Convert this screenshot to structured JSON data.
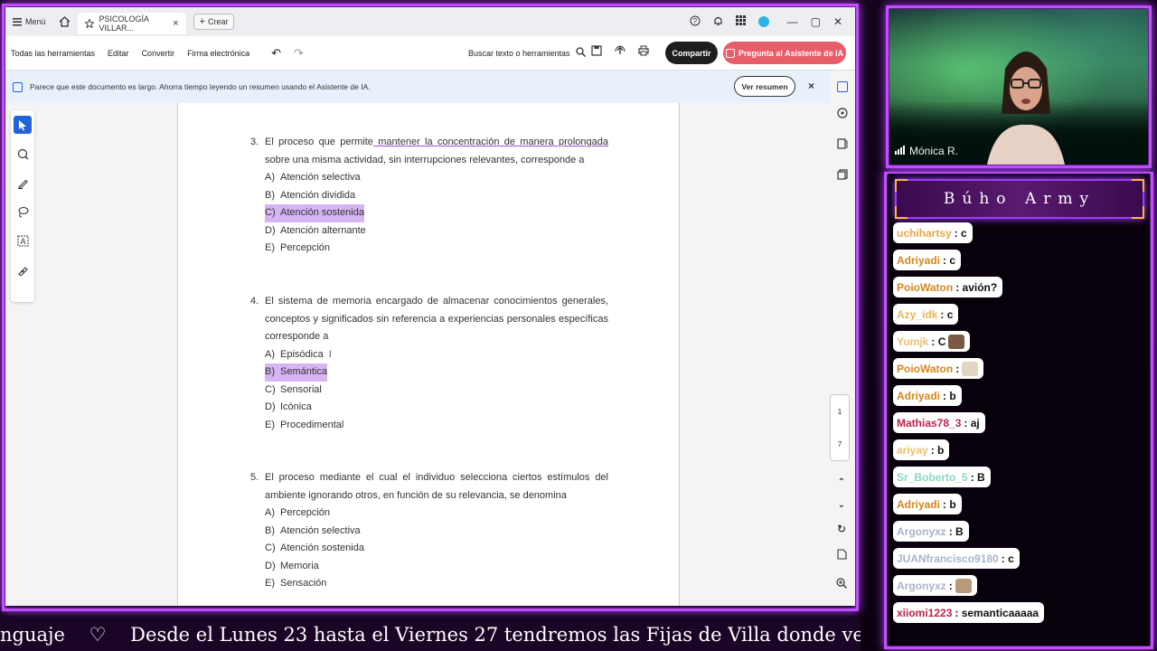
{
  "app": {
    "menu_label": "Menú",
    "tab_title": "PSICOLOGÍA VILLAR...",
    "new_tab_label": "Crear",
    "toolbar": {
      "all_tools": "Todas las herramientas",
      "edit": "Editar",
      "convert": "Convertir",
      "esign": "Firma electrónica",
      "search_placeholder": "Buscar texto o herramientas",
      "share": "Compartir",
      "ask_ai": "Pregunta al Asistente de IA"
    },
    "banner": {
      "text": "Parece que este documento es largo. Ahorra tiempo leyendo un resumen usando el Asistente de IA.",
      "summary_button": "Ver resumen",
      "close": "×"
    },
    "page_control": {
      "current": "1",
      "total": "7"
    }
  },
  "document": {
    "questions": [
      {
        "number": "3.",
        "text_before": "El proceso que permite",
        "text_underlined": " mantener la concentración de manera prolongada",
        "text_after": " sobre una misma actividad, sin interrupciones relevantes, corresponde a",
        "options": [
          {
            "letter": "A)",
            "text": "Atención selectiva",
            "highlighted": false
          },
          {
            "letter": "B)",
            "text": "Atención dividida",
            "highlighted": false
          },
          {
            "letter": "C)",
            "text": "Atención sostenida",
            "highlighted": true
          },
          {
            "letter": "D)",
            "text": "Atención alternante",
            "highlighted": false
          },
          {
            "letter": "E)",
            "text": "Percepción",
            "highlighted": false
          }
        ]
      },
      {
        "number": "4.",
        "text_before": "El sistema de memoria encargado de almacenar conocimientos generales, conceptos y significados sin referencia a experiencias personales específicas corresponde a",
        "text_underlined": "",
        "text_after": "",
        "options": [
          {
            "letter": "A)",
            "text": "Episódica",
            "highlighted": false
          },
          {
            "letter": "B)",
            "text": "Semántica",
            "highlighted": true
          },
          {
            "letter": "C)",
            "text": "Sensorial",
            "highlighted": false
          },
          {
            "letter": "D)",
            "text": "Icónica",
            "highlighted": false
          },
          {
            "letter": "E)",
            "text": "Procedimental",
            "highlighted": false
          }
        ]
      },
      {
        "number": "5.",
        "text_before": "El proceso mediante el cual el individuo selecciona ciertos estímulos del ambiente ignorando otros, en función de su relevancia, se denomina",
        "text_underlined": "",
        "text_after": "",
        "options": [
          {
            "letter": "A)",
            "text": "Percepción",
            "highlighted": false
          },
          {
            "letter": "B)",
            "text": "Atención selectiva",
            "highlighted": false
          },
          {
            "letter": "C)",
            "text": "Atención sostenida",
            "highlighted": false
          },
          {
            "letter": "D)",
            "text": "Memoria",
            "highlighted": false
          },
          {
            "letter": "E)",
            "text": "Sensación",
            "highlighted": false
          }
        ]
      }
    ]
  },
  "webcam": {
    "name": "Mónica R."
  },
  "chat": {
    "title": "Búho Army",
    "messages": [
      {
        "user": "uchihartsy",
        "text": ": c",
        "color": "#e8a84a",
        "emote": ""
      },
      {
        "user": "Adriyadi",
        "text": ": c",
        "color": "#d4871a",
        "emote": ""
      },
      {
        "user": "PoioWaton",
        "text": ": avión?",
        "color": "#d4871a",
        "emote": ""
      },
      {
        "user": "Azy_idk",
        "text": ": c",
        "color": "#e8b85a",
        "emote": ""
      },
      {
        "user": "Yumjk",
        "text": ": C",
        "color": "#f0c070",
        "emote": "cat-emote"
      },
      {
        "user": "PoioWaton",
        "text": ":",
        "color": "#d4871a",
        "emote": "dog-emote"
      },
      {
        "user": "Adriyadi",
        "text": ": b",
        "color": "#d4871a",
        "emote": ""
      },
      {
        "user": "Mathias78_3",
        "text": ": aj",
        "color": "#c0224a",
        "emote": ""
      },
      {
        "user": "ariyay",
        "text": ": b",
        "color": "#f0c070",
        "emote": ""
      },
      {
        "user": "Sr_Boberto_5",
        "text": ": B",
        "color": "#8ad6c8",
        "emote": ""
      },
      {
        "user": "Adriyadi",
        "text": ": b",
        "color": "#d4871a",
        "emote": ""
      },
      {
        "user": "Argonyxz",
        "text": ": B",
        "color": "#a8b4c8",
        "emote": ""
      },
      {
        "user": "JUANfrancisco9180",
        "text": ": c",
        "color": "#a8b4c8",
        "emote": ""
      },
      {
        "user": "Argonyxz",
        "text": ":",
        "color": "#a8b4c8",
        "emote": "owl-emote"
      },
      {
        "user": "xiiomi1223",
        "text": ": semanticaaaaa",
        "color": "#c0224a",
        "emote": ""
      }
    ]
  },
  "ticker": {
    "text": "nguaje    ♡    Desde el Lunes 23 hasta el Viernes 27 tendremos las Fijas de Villa donde veremos"
  }
}
